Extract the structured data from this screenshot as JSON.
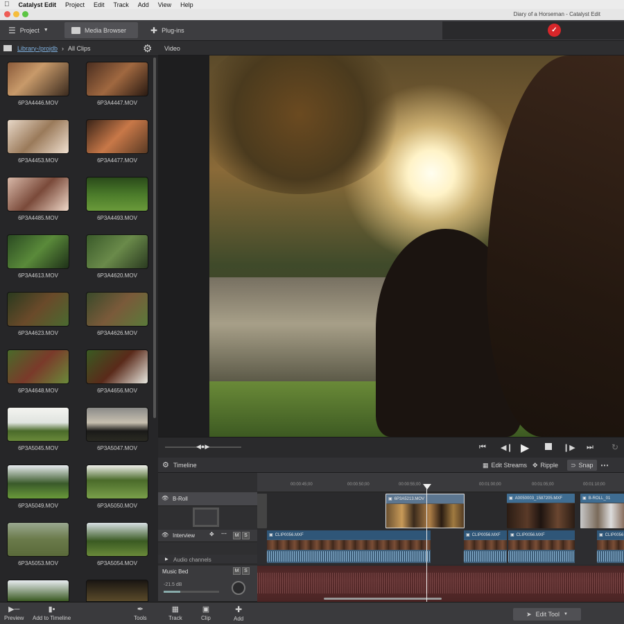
{
  "menubar": {
    "app": "Catalyst Edit",
    "items": [
      "Project",
      "Edit",
      "Track",
      "Add",
      "View",
      "Help"
    ]
  },
  "window": {
    "title": "Diary of a Horseman - Catalyst Edit"
  },
  "toolbar": {
    "project_label": "Project",
    "media_browser_label": "Media Browser",
    "plugins_label": "Plug-ins"
  },
  "library": {
    "crumb_path": "Library-/projdb",
    "crumb_current": "All Clips",
    "clips": [
      "6P3A4446.MOV",
      "6P3A4447.MOV",
      "6P3A4453.MOV",
      "6P3A4477.MOV",
      "6P3A4485.MOV",
      "6P3A4493.MOV",
      "6P3A4613.MOV",
      "6P3A4620.MOV",
      "6P3A4623.MOV",
      "6P3A4626.MOV",
      "6P3A4648.MOV",
      "6P3A4656.MOV",
      "6P3A5045.MOV",
      "6P3A5047.MOV",
      "6P3A5049.MOV",
      "6P3A5050.MOV",
      "6P3A5053.MOV",
      "6P3A5054.MOV"
    ]
  },
  "viewer": {
    "label": "Video"
  },
  "timeline": {
    "label": "Timeline",
    "edit_streams": "Edit Streams",
    "ripple": "Ripple",
    "snap": "Snap",
    "ruler": [
      "00:00:45;00",
      "00:00:50;00",
      "00:00:55;00",
      "00:01:00;00",
      "00:01:05;00",
      "00:01:10;00"
    ],
    "tracks": {
      "broll": "B-Roll",
      "interview": "Interview",
      "audio_channels": "Audio channels",
      "music": "Music Bed",
      "volume": "-21.5 dB"
    },
    "clips_broll": [
      "6P3A5213.MOV",
      "A0050003_1587205.MXF",
      "B-ROLL_01"
    ],
    "clips_interview": [
      "CLIP0056.MXF",
      "CLIP0056.MXF",
      "CLIP0056.MXF",
      "CLIP0056"
    ]
  },
  "bottom": {
    "preview": "Preview",
    "add_to_timeline": "Add to Timeline",
    "tools": "Tools",
    "track": "Track",
    "clip": "Clip",
    "add": "Add",
    "edit_tool": "Edit Tool"
  },
  "colors": {
    "accent": "#4a90c4",
    "clip_blue": "#3f6d92",
    "music_red": "#5a2c2c"
  }
}
